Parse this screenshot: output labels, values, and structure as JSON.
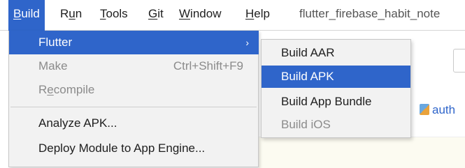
{
  "menubar": {
    "items": [
      {
        "label": "Build",
        "mnemonic": "B",
        "rest": "uild"
      },
      {
        "label": "Run",
        "pre": "R",
        "mnemonic": "u",
        "rest": "n"
      },
      {
        "label": "Tools",
        "mnemonic": "T",
        "rest": "ools"
      },
      {
        "label": "Git",
        "mnemonic": "G",
        "rest": "it"
      },
      {
        "label": "Window",
        "mnemonic": "W",
        "rest": "indow"
      },
      {
        "label": "Help",
        "mnemonic": "H",
        "rest": "elp"
      }
    ],
    "project_title": "flutter_firebase_habit_note"
  },
  "build_menu": {
    "items": [
      {
        "label": "Flutter",
        "shortcut": "",
        "state": "highlighted",
        "has_submenu": true,
        "arrow": "›"
      },
      {
        "label": "Make",
        "shortcut": "Ctrl+Shift+F9",
        "state": "disabled"
      },
      {
        "label_pre": "R",
        "label_mnemonic": "e",
        "label_rest": "compile",
        "state": "disabled"
      },
      {
        "label": "Analyze APK...",
        "state": "normal"
      },
      {
        "label": "Deploy Module to App Engine...",
        "state": "normal"
      }
    ]
  },
  "flutter_submenu": {
    "items": [
      {
        "label": "Build AAR",
        "state": "normal"
      },
      {
        "label": "Build APK",
        "state": "highlighted"
      },
      {
        "label": "Build App Bundle",
        "state": "normal"
      },
      {
        "label": "Build iOS",
        "state": "disabled"
      }
    ]
  },
  "background": {
    "file_tab_text": "auth"
  },
  "colors": {
    "accent": "#2f65ca",
    "menu_bg": "#f2f2f2",
    "disabled_text": "#8b8b8b",
    "editor_bg": "#fcfbf1"
  }
}
